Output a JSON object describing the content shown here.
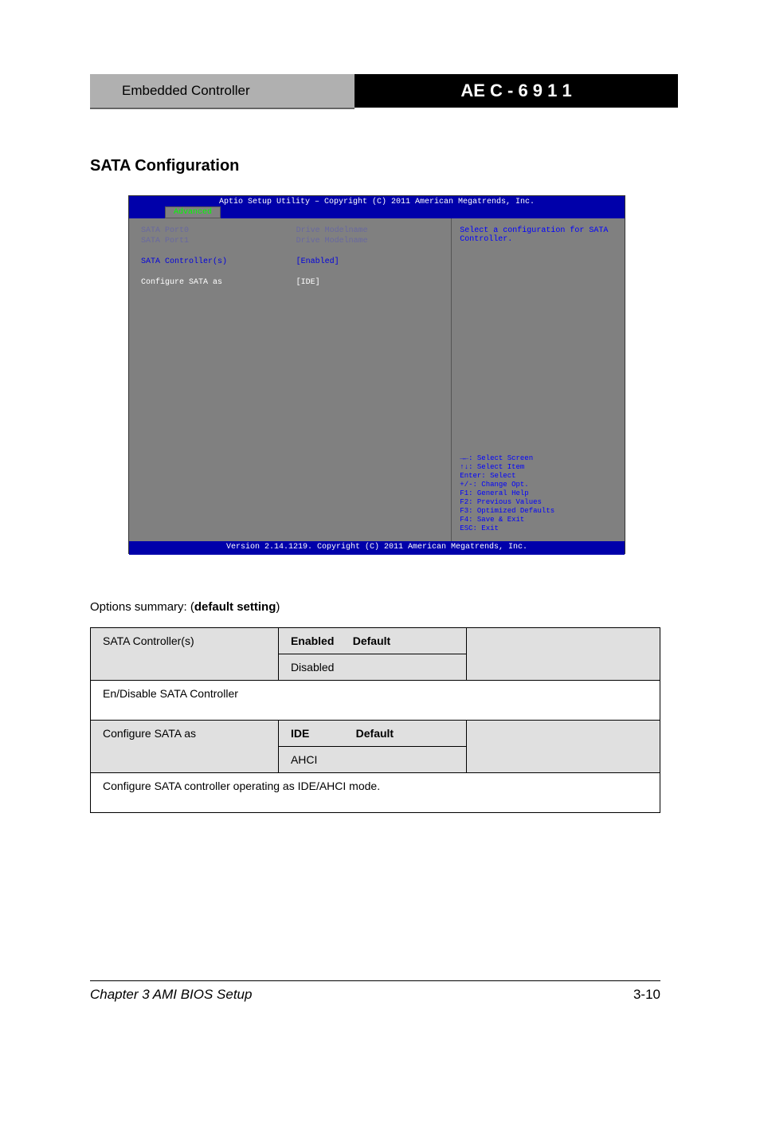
{
  "header": {
    "left": "Embedded Controller",
    "right": "AE C - 6 9 1 1"
  },
  "section_title": "SATA Configuration",
  "bios": {
    "title": "Aptio Setup Utility – Copyright (C) 2011 American Megatrends, Inc.",
    "tab": "Advanced",
    "rows": [
      {
        "label": "SATA Port0",
        "value": "Drive Modelname",
        "type": "info"
      },
      {
        "label": "SATA Port1",
        "value": "Drive Modelname",
        "type": "info"
      },
      {
        "label": "",
        "value": "",
        "type": "spacer"
      },
      {
        "label": "  SATA Controller(s)",
        "value": "[Enabled]",
        "type": "active"
      },
      {
        "label": "",
        "value": "",
        "type": "spacer"
      },
      {
        "label": "  Configure SATA as",
        "value": "[IDE]",
        "type": "highlighted"
      }
    ],
    "help_text": "Select a configuration for SATA Controller.",
    "keys": [
      "→←: Select Screen",
      "↑↓: Select Item",
      "Enter: Select",
      "+/-: Change Opt.",
      "F1: General Help",
      "F2: Previous Values",
      "F3: Optimized Defaults",
      "F4: Save & Exit",
      "ESC: Exit"
    ],
    "footer": "Version 2.14.1219. Copyright (C) 2011 American Megatrends, Inc."
  },
  "options_label": "Options summary: (default setting)",
  "table": {
    "row1": {
      "name": "SATA Controller(s)",
      "opt1": "Enabled",
      "opt1_suffix": "Default",
      "opt2": "Disabled",
      "desc1": ""
    },
    "desc1": "En/Disable SATA Controller",
    "row2": {
      "name": "Configure SATA as",
      "opt1": "IDE",
      "opt1_suffix": "Default",
      "opt2": "AHCI",
      "desc2": ""
    },
    "desc2": "Configure SATA controller operating as IDE/AHCI mode."
  },
  "chapter": "Chapter 3 AMI BIOS Setup",
  "page": "3-10"
}
